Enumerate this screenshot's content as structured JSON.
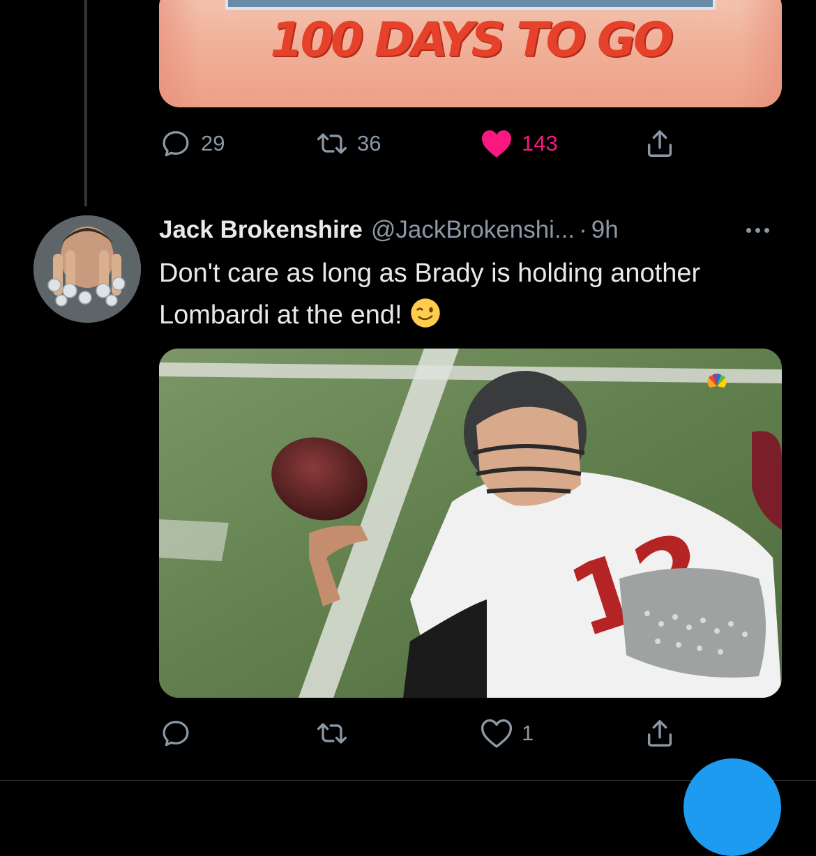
{
  "colors": {
    "background": "#000000",
    "text_primary": "#e7e9ea",
    "text_secondary": "#8b98a5",
    "like_pink": "#f91880",
    "accent_blue": "#1d9bf0",
    "banner_red": "#e5412b"
  },
  "previous_tweet": {
    "media_banner_text": "100 DAYS TO GO",
    "actions": {
      "reply": {
        "icon": "reply-icon",
        "count": "29"
      },
      "retweet": {
        "icon": "retweet-icon",
        "count": "36"
      },
      "like": {
        "icon": "heart-filled-icon",
        "count": "143",
        "liked": true
      },
      "share": {
        "icon": "share-icon"
      }
    }
  },
  "reply_tweet": {
    "display_name": "Jack Brokenshire",
    "handle": "@JackBrokenshi...",
    "separator": "·",
    "time": "9h",
    "text": "Don't care as long as Brady is holding another Lombardi at the end!",
    "emoji": "winking-face-emoji",
    "media": {
      "jersey_number": "12"
    },
    "actions": {
      "reply": {
        "icon": "reply-icon",
        "count": ""
      },
      "retweet": {
        "icon": "retweet-icon",
        "count": ""
      },
      "like": {
        "icon": "heart-outline-icon",
        "count": "1",
        "liked": false
      },
      "share": {
        "icon": "share-icon"
      }
    }
  }
}
